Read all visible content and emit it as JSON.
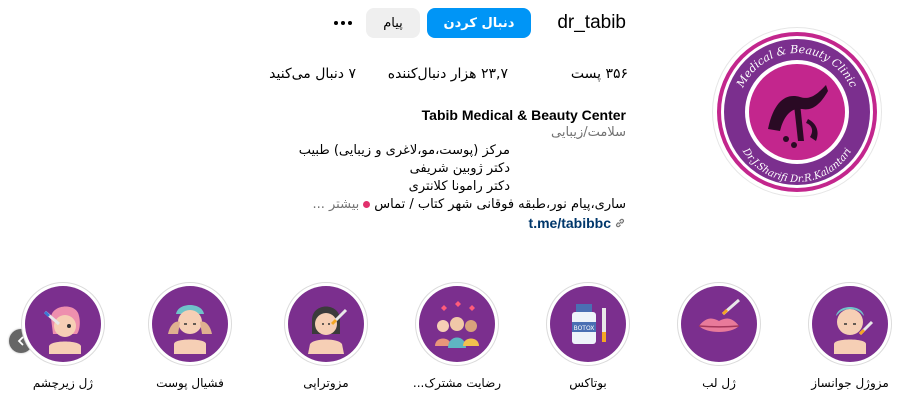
{
  "profile": {
    "username": "dr_tabib",
    "follow_label": "دنبال کردن",
    "message_label": "پیام",
    "more_icon": "more-horizontal-icon"
  },
  "avatar": {
    "ring_text_top": "Medical & Beauty Clinic",
    "ring_text_bottom": "Dr.J.Sharifi   Dr.R.Kalantari",
    "center_text": "طبیب",
    "color_ring": "#7b2f8e",
    "color_center": "#c3268d"
  },
  "stats": {
    "posts": "۳۵۶ پست",
    "followers": "۲۳,۷ هزار دنبال‌کننده",
    "following": "۷ دنبال می‌کنید"
  },
  "bio": {
    "name": "Tabib Medical & Beauty Center",
    "category": "سلامت/زیبایی",
    "line1": "مرکز (پوست،مو،لاغری و زیبایی) طبیب",
    "line2": "دکتر ژوبین شریفی",
    "line3": "دکتر رامونا کلانتری",
    "address": "ساری،پیام نور،طبقه فوقانی شهر کتاب / تماس",
    "more": "بیشتر ...",
    "link": "t.me/tabibbc"
  },
  "highlights": [
    {
      "label": "مزوژل جوانساز",
      "icon": "face-mesogel-icon"
    },
    {
      "label": "ژل لب",
      "icon": "lips-filler-icon"
    },
    {
      "label": "بوتاکس",
      "icon": "botox-bottle-icon"
    },
    {
      "label": "رضایت مشترک...",
      "icon": "satisfied-clients-icon"
    },
    {
      "label": "مزوتراپی",
      "icon": "mesotherapy-face-icon"
    },
    {
      "label": "فشیال پوست",
      "icon": "facial-massage-icon"
    },
    {
      "label": "ژل زیرچشم",
      "icon": "under-eye-gel-icon"
    }
  ],
  "colors": {
    "primary": "#0095f6",
    "highlight_bg": "#7b2f8e",
    "link": "#00376b"
  }
}
